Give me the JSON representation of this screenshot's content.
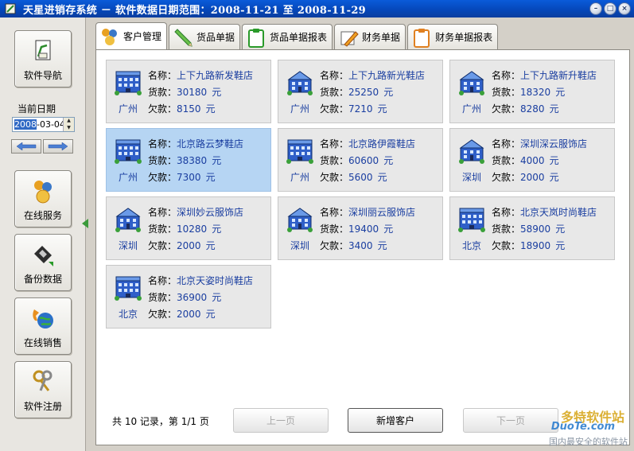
{
  "window": {
    "title": "天星进销存系统 － 软件数据日期范围：2008-11-21 至 2008-11-29"
  },
  "sidebar": {
    "nav_label": "软件导航",
    "date_label": "当前日期",
    "date_value": "2008-03-04",
    "date_selected_part": "2008",
    "date_rest": "-03-04",
    "buttons": [
      {
        "label": "在线服务"
      },
      {
        "label": "备份数据"
      },
      {
        "label": "在线销售"
      },
      {
        "label": "软件注册"
      }
    ]
  },
  "tabs": [
    {
      "label": "客户管理",
      "icon": "users-icon"
    },
    {
      "label": "货品单据",
      "icon": "pencil-icon"
    },
    {
      "label": "货品单据报表",
      "icon": "clipboard-icon"
    },
    {
      "label": "财务单据",
      "icon": "pen-icon"
    },
    {
      "label": "财务单据报表",
      "icon": "clipboard-icon"
    }
  ],
  "labels": {
    "name": "名称：",
    "goods": "货款：",
    "debt": "欠款：",
    "unit": "元"
  },
  "customers": [
    {
      "name": "上下九路新发鞋店",
      "goods": "30180",
      "debt": "8150",
      "city": "广州",
      "icon": "building-a"
    },
    {
      "name": "上下九路新光鞋店",
      "goods": "25250",
      "debt": "7210",
      "city": "广州",
      "icon": "building-b"
    },
    {
      "name": "上下九路新升鞋店",
      "goods": "18320",
      "debt": "8280",
      "city": "广州",
      "icon": "building-b"
    },
    {
      "name": "北京路云梦鞋店",
      "goods": "38380",
      "debt": "7300",
      "city": "广州",
      "icon": "building-a"
    },
    {
      "name": "北京路伊霞鞋店",
      "goods": "60600",
      "debt": "5600",
      "city": "广州",
      "icon": "building-a"
    },
    {
      "name": "深圳深云服饰店",
      "goods": "4000",
      "debt": "2000",
      "city": "深圳",
      "icon": "building-b"
    },
    {
      "name": "深圳妙云服饰店",
      "goods": "10280",
      "debt": "2000",
      "city": "深圳",
      "icon": "building-b"
    },
    {
      "name": "深圳丽云服饰店",
      "goods": "19400",
      "debt": "3400",
      "city": "深圳",
      "icon": "building-b"
    },
    {
      "name": "北京天岚时尚鞋店",
      "goods": "58900",
      "debt": "18900",
      "city": "北京",
      "icon": "building-a"
    },
    {
      "name": "北京天姿时尚鞋店",
      "goods": "36900",
      "debt": "2000",
      "city": "北京",
      "icon": "building-a"
    }
  ],
  "footer": {
    "summary": "共 10 记录，第 1/1 页",
    "prev_label": "上一页",
    "add_label": "新增客户",
    "next_label": "下一页"
  },
  "watermark": {
    "line1": "多特软件站",
    "line2": "DuoTe.com",
    "line3": "国内最安全的软件站"
  },
  "colors": {
    "titlebar": "#0546b8",
    "card_bg": "#e8e8e8",
    "card_selected": "#b6d5f3",
    "value_text": "#1a3ea0"
  }
}
